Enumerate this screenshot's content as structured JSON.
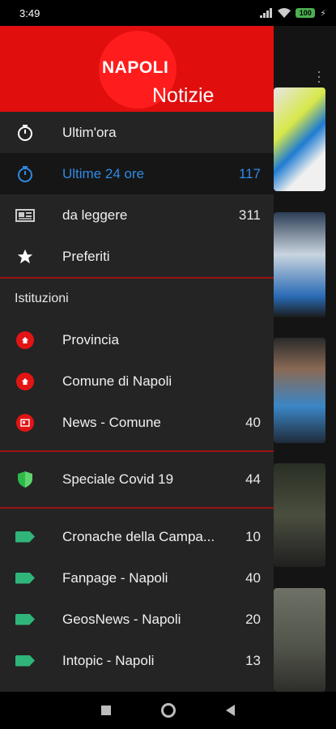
{
  "status_bar": {
    "time": "3:49",
    "battery": "100"
  },
  "header": {
    "logo_top": "NAPOLI",
    "logo_bottom": "Notizie"
  },
  "menu": [
    {
      "label": "Ultim'ora",
      "count": "",
      "icon": "stopwatch-icon"
    },
    {
      "label": "Ultime 24 ore",
      "count": "117",
      "icon": "stopwatch-icon",
      "active": true
    },
    {
      "label": "da leggere",
      "count": "311",
      "icon": "newspaper-icon"
    },
    {
      "label": "Preferiti",
      "count": "",
      "icon": "star-icon"
    }
  ],
  "institutions": {
    "title": "Istituzioni",
    "items": [
      {
        "label": "Provincia",
        "count": "",
        "icon": "home-badge-icon"
      },
      {
        "label": "Comune di Napoli",
        "count": "",
        "icon": "home-badge-icon"
      },
      {
        "label": "News - Comune",
        "count": "40",
        "icon": "news-badge-icon"
      }
    ]
  },
  "special": {
    "label": "Speciale Covid 19",
    "count": "44",
    "icon": "shield-icon"
  },
  "sources": [
    {
      "label": "Cronache della Campa...",
      "count": "10",
      "icon": "tag-icon"
    },
    {
      "label": "Fanpage - Napoli",
      "count": "40",
      "icon": "tag-icon"
    },
    {
      "label": "GeosNews - Napoli",
      "count": "20",
      "icon": "tag-icon"
    },
    {
      "label": "Intopic - Napoli",
      "count": "13",
      "icon": "tag-icon"
    }
  ],
  "colors": {
    "header_red": "#e10e0e",
    "active_blue": "#2f8ae6",
    "divider_red": "#9c1212",
    "tag_green": "#2fb57a"
  }
}
